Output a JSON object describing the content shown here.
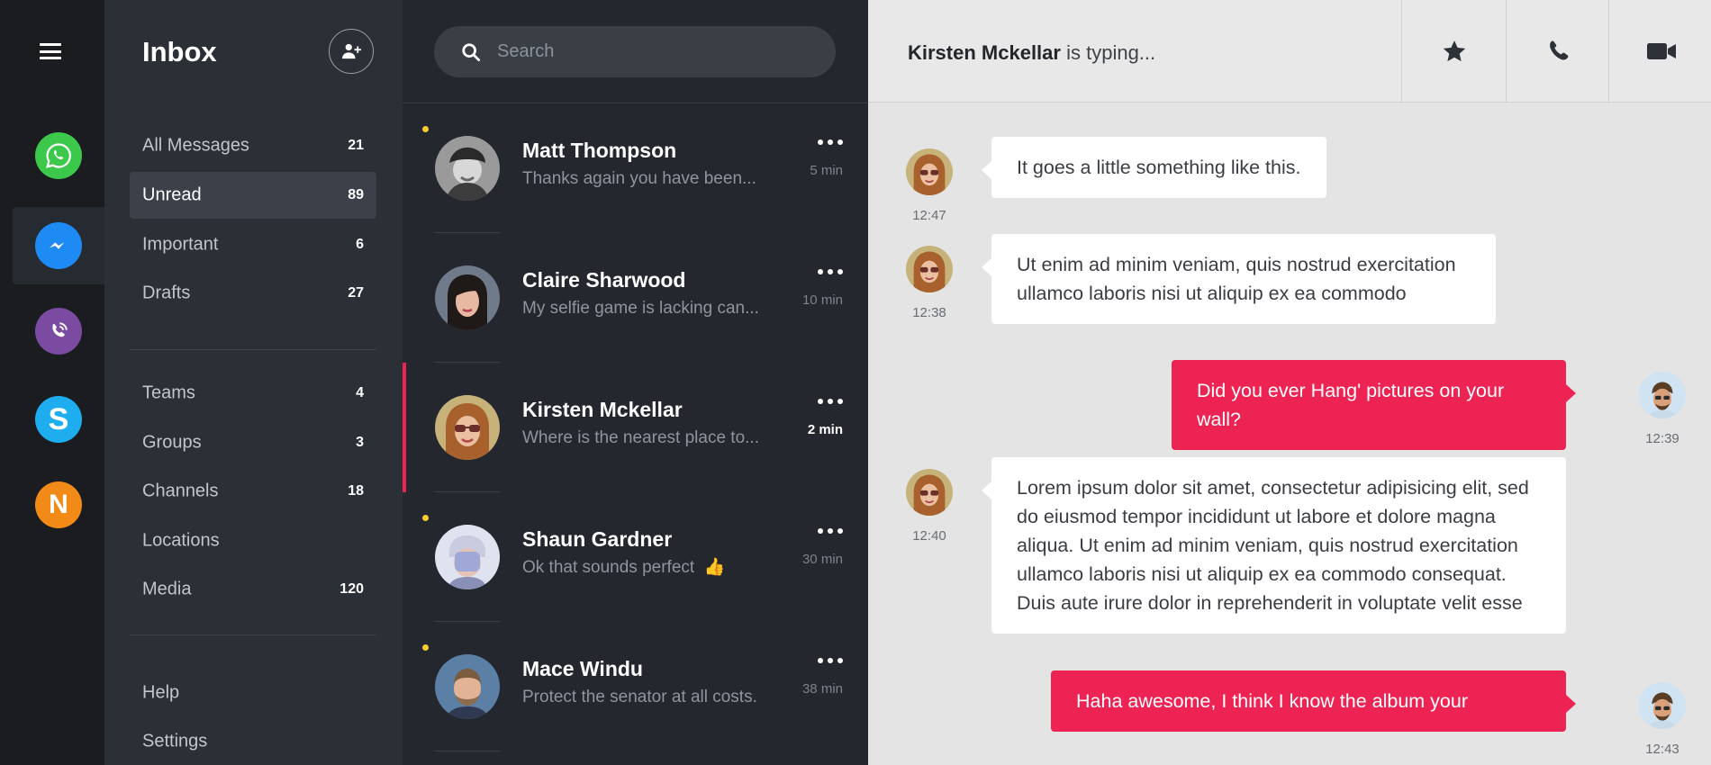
{
  "apps": [
    {
      "name": "WhatsApp",
      "icon": "whatsapp-icon",
      "color": "#3cc84a"
    },
    {
      "name": "Messenger",
      "icon": "messenger-icon",
      "color": "#1e8bf5"
    },
    {
      "name": "Viber",
      "icon": "viber-icon",
      "color": "#7a4ba0"
    },
    {
      "name": "Skype",
      "icon": "skype-icon",
      "color": "#1eaef0"
    },
    {
      "name": "N",
      "icon": "n-app-icon",
      "color": "#f28a17",
      "letter": "N"
    }
  ],
  "inbox": {
    "title": "Inbox",
    "folders": [
      {
        "label": "All Messages",
        "count": "21"
      },
      {
        "label": "Unread",
        "count": "89",
        "active": true
      },
      {
        "label": "Important",
        "count": "6"
      },
      {
        "label": "Drafts",
        "count": "27"
      }
    ],
    "groups": [
      {
        "label": "Teams",
        "count": "4"
      },
      {
        "label": "Groups",
        "count": "3"
      },
      {
        "label": "Channels",
        "count": "18"
      },
      {
        "label": "Locations",
        "count": ""
      },
      {
        "label": "Media",
        "count": "120"
      }
    ],
    "footer": [
      {
        "label": "Help"
      },
      {
        "label": "Settings"
      }
    ]
  },
  "search": {
    "placeholder": "Search"
  },
  "conversations": [
    {
      "name": "Matt Thompson",
      "preview": "Thanks again you have been...",
      "time": "5 min",
      "unread": true
    },
    {
      "name": "Claire Sharwood",
      "preview": "My selfie game is lacking can...",
      "time": "10 min",
      "unread": false
    },
    {
      "name": "Kirsten Mckellar",
      "preview": "Where is the nearest place to...",
      "time": "2 min",
      "unread": false,
      "selected": true
    },
    {
      "name": "Shaun Gardner",
      "preview": "Ok that sounds perfect",
      "emoji": "👍",
      "time": "30 min",
      "unread": true
    },
    {
      "name": "Mace Windu",
      "preview": "Protect the senator at all costs.",
      "time": "38 min",
      "unread": true
    }
  ],
  "chat": {
    "contact": "Kirsten Mckellar",
    "status": "is typing...",
    "header_buttons": [
      "star-icon",
      "phone-icon",
      "video-icon"
    ],
    "messages": [
      {
        "dir": "in",
        "text": "It goes a little something like this.",
        "time": "12:47"
      },
      {
        "dir": "in",
        "text": "Ut enim ad minim veniam, quis nostrud exercitation ullamco laboris nisi ut aliquip ex ea commodo",
        "time": "12:38"
      },
      {
        "dir": "out",
        "text": "Did you ever Hang' pictures on your wall?",
        "time": "12:39"
      },
      {
        "dir": "in",
        "text": "Lorem ipsum dolor sit amet, consectetur adipisicing elit, sed do eiusmod tempor incididunt ut labore et dolore magna aliqua. Ut enim ad minim veniam, quis nostrud exercitation ullamco laboris nisi ut aliquip ex ea commodo consequat. Duis aute irure dolor in reprehenderit in voluptate velit esse",
        "time": "12:40"
      },
      {
        "dir": "out",
        "text": "Haha awesome,  I think I know the album your",
        "time": "12:43"
      }
    ]
  }
}
